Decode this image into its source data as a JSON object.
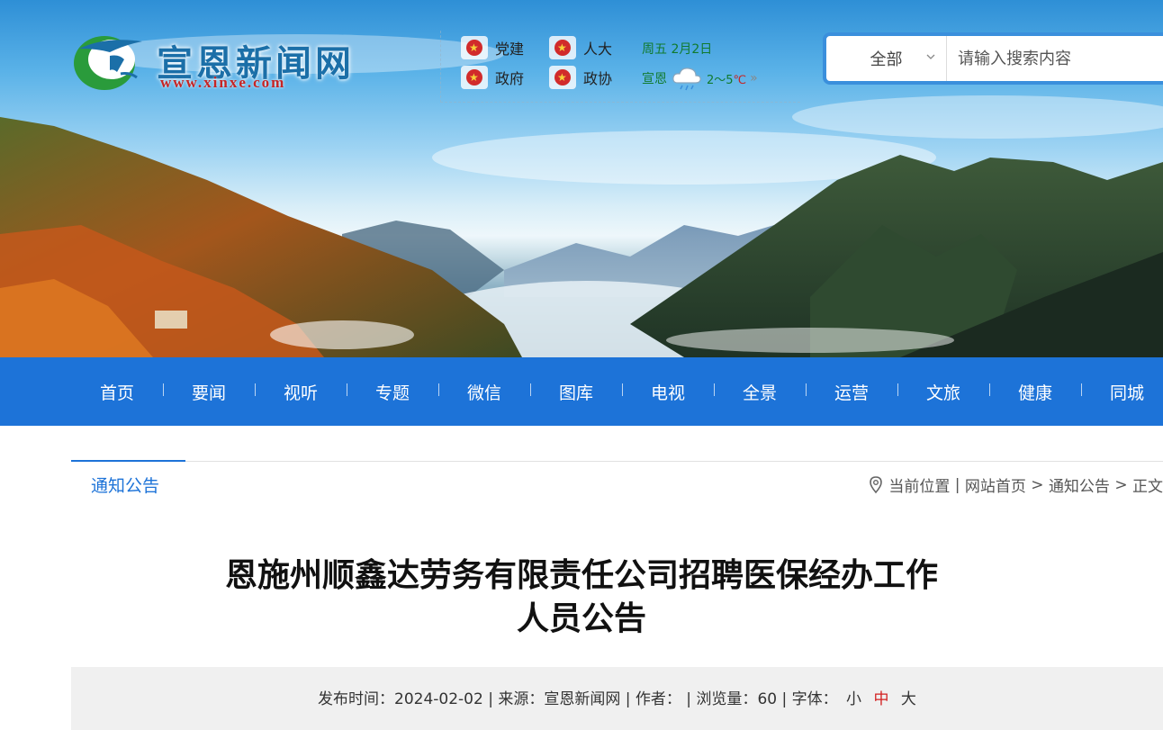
{
  "logo": {
    "text": "宣恩新闻网",
    "url": "www.xinxe.com"
  },
  "quick_links": [
    {
      "label": "党建",
      "icon": "party-emblem-icon"
    },
    {
      "label": "人大",
      "icon": "national-emblem-icon"
    },
    {
      "label": "政府",
      "icon": "national-emblem-icon"
    },
    {
      "label": "政协",
      "icon": "cppcc-emblem-icon"
    }
  ],
  "date": "周五 2月2日",
  "weather": {
    "city": "宣恩",
    "temp": "2～5",
    "unit": "℃",
    "more": "»",
    "icon": "rain-cloud-icon"
  },
  "search": {
    "scope": "全部",
    "placeholder": "请输入搜索内容"
  },
  "nav": [
    "首页",
    "要闻",
    "视听",
    "专题",
    "微信",
    "图库",
    "电视",
    "全景",
    "运营",
    "文旅",
    "健康",
    "同城"
  ],
  "section_tab": "通知公告",
  "breadcrumb": {
    "prefix": "当前位置",
    "sep": "|",
    "home": "网站首页",
    "arrow1": ">",
    "section": "通知公告",
    "arrow2": ">",
    "current": "正文"
  },
  "article": {
    "title_line1": "恩施州顺鑫达劳务有限责任公司招聘医保经办工作",
    "title_line2": "人员公告"
  },
  "meta": {
    "publish_label": "发布时间：",
    "publish_date": "2024-02-02",
    "source_label": "来源：",
    "source": "宣恩新闻网",
    "author_label": "作者：",
    "author": "",
    "views_label": "浏览量：",
    "views": "60",
    "font_label": "字体：",
    "font_small": "小",
    "font_medium": "中",
    "font_large": "大",
    "separator": "|"
  },
  "colors": {
    "nav": "#1d73d8",
    "accent_red": "#d21f1f",
    "weather_green": "#117a2e"
  }
}
